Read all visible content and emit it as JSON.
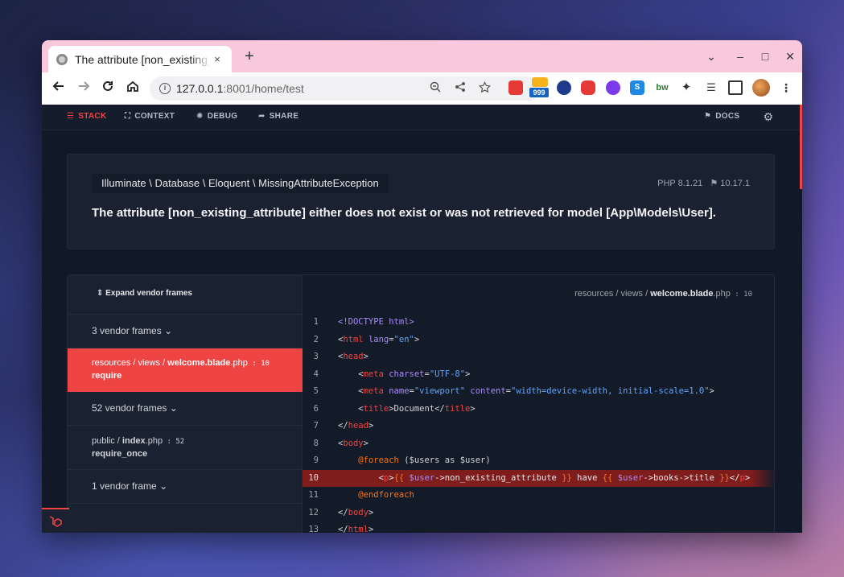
{
  "browser": {
    "tab_title": "The attribute [non_existing_attribute] either does not exist",
    "tab_close": "×",
    "new_tab": "+",
    "url_host": "127.0.0.1",
    "url_rest": ":8001/home/test",
    "ext_badge": "999",
    "window_controls": [
      "⌄",
      "–",
      "□",
      "✕"
    ]
  },
  "nav": {
    "stack": "STACK",
    "context": "CONTEXT",
    "debug": "DEBUG",
    "share": "SHARE",
    "docs": "DOCS"
  },
  "exception": {
    "class_parts": [
      "Illuminate",
      "Database",
      "Eloquent",
      "MissingAttributeException"
    ],
    "class_label": "Illuminate \\ Database \\ Eloquent \\ MissingAttributeException",
    "php_version": "PHP 8.1.21",
    "laravel_version": "10.17.1",
    "message": "The attribute [non_existing_attribute] either does not exist or was not retrieved for model [App\\Models\\User]."
  },
  "frames": {
    "expand_label": "Expand vendor frames",
    "vendor1": "3 vendor frames",
    "active_path_prefix": "resources / views / ",
    "active_file": "welcome.blade",
    "active_ext": ".php",
    "active_line": " : 10",
    "active_fn": "require",
    "vendor2": "52 vendor frames",
    "public_prefix": "public / ",
    "public_file": "index",
    "public_ext": ".php",
    "public_line": " : 52",
    "public_fn": "require_once",
    "vendor3": "1 vendor frame"
  },
  "code": {
    "header_prefix": "resources / views / ",
    "header_file": "welcome.blade",
    "header_ext": ".php",
    "header_line": " : 10",
    "highlight_line": 10,
    "lines": [
      {
        "n": "1"
      },
      {
        "n": "2"
      },
      {
        "n": "3"
      },
      {
        "n": "4"
      },
      {
        "n": "5"
      },
      {
        "n": "6"
      },
      {
        "n": "7"
      },
      {
        "n": "8"
      },
      {
        "n": "9"
      },
      {
        "n": "10"
      },
      {
        "n": "11"
      },
      {
        "n": "12"
      },
      {
        "n": "13"
      }
    ]
  },
  "colors": {
    "accent": "#ef4444",
    "background": "#111827",
    "panel": "#1a2231",
    "tab_strip": "#f8c9dc"
  }
}
